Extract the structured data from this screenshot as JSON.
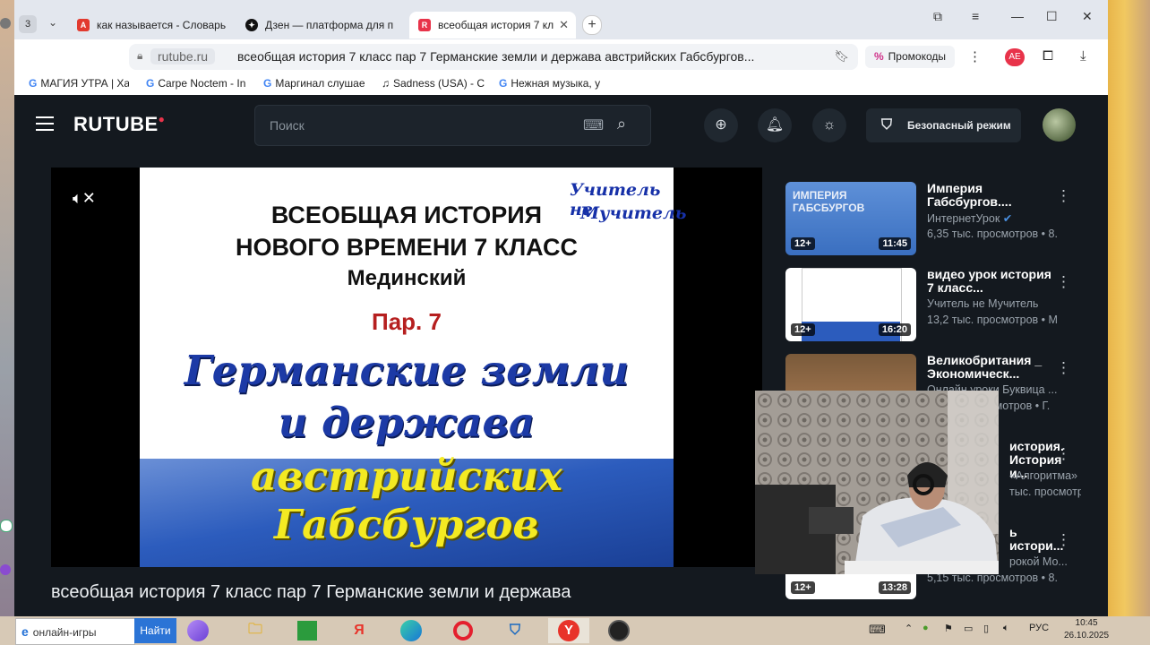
{
  "browser": {
    "tab_count": "3",
    "tabs": [
      {
        "label": "как называется - Словарь",
        "icon": "yandex-dictionary-icon"
      },
      {
        "label": "Дзен — платформа для п",
        "icon": "dzen-icon"
      },
      {
        "label": "всеобщая история 7 кл",
        "icon": "rutube-icon"
      }
    ],
    "address": {
      "domain": "rutube.ru",
      "page_title": "всеобщая история 7 класс пар 7 Германские земли и держава австрийских Габсбургов..."
    },
    "promo_label": "Промокоды",
    "bookmarks": [
      "МАГИЯ УТРА | Ха",
      "Carpe Noctem - In",
      "Маргинал слушае",
      "Sadness (USA) - C",
      "Нежная музыка, у"
    ]
  },
  "rutube": {
    "logo": "RUTUBE",
    "search_placeholder": "Поиск",
    "safe_mode_label": "Безопасный режим",
    "video": {
      "slide": {
        "line1": "ВСЕОБЩАЯ ИСТОРИЯ",
        "line2": "НОВОГО ВРЕМЕНИ 7 КЛАСС",
        "author": "Мединский",
        "paragraph": "Пар. 7",
        "title_line1": "Германские земли",
        "title_line2": "и держава",
        "title_line3": "австрийских",
        "title_line4": "Габсбургов",
        "watermark_line1": "Учитель не",
        "watermark_line2": "Мучитель"
      },
      "title": "всеобщая история 7 класс пар 7 Германские земли и держава"
    },
    "recommendations": [
      {
        "title": "Империя Габсбургов....",
        "channel": "ИнтернетУрок",
        "views": "6,35 тыс. просмотров • 8.",
        "age": "12+",
        "duration": "11:45",
        "thumb_text": "ИМПЕРИЯ ГАБСБУРГОВ"
      },
      {
        "title": "видео урок история 7 класс...",
        "channel": "Учитель не Мучитель",
        "views": "13,2 тыс. просмотров • М",
        "age": "12+",
        "duration": "16:20"
      },
      {
        "title": "Великобритания _ Экономическ...",
        "channel": "Онлайн уроки Буквица ...",
        "views": "6,3 тыс. просмотров • Г."
      },
      {
        "title": "история. История и...",
        "channel": "«Алгоритма»",
        "views": "тыс. просмотров • 5."
      },
      {
        "title": "ь истори...",
        "channel": "рокой Мо...",
        "views": "5,15 тыс. просмотров • 8.",
        "age": "12+",
        "duration": "13:28"
      }
    ]
  },
  "taskbar": {
    "search_text": "онлайн-игры",
    "search_button": "Найти",
    "language": "РУС",
    "time": "10:45",
    "date": "26.10.2025"
  }
}
